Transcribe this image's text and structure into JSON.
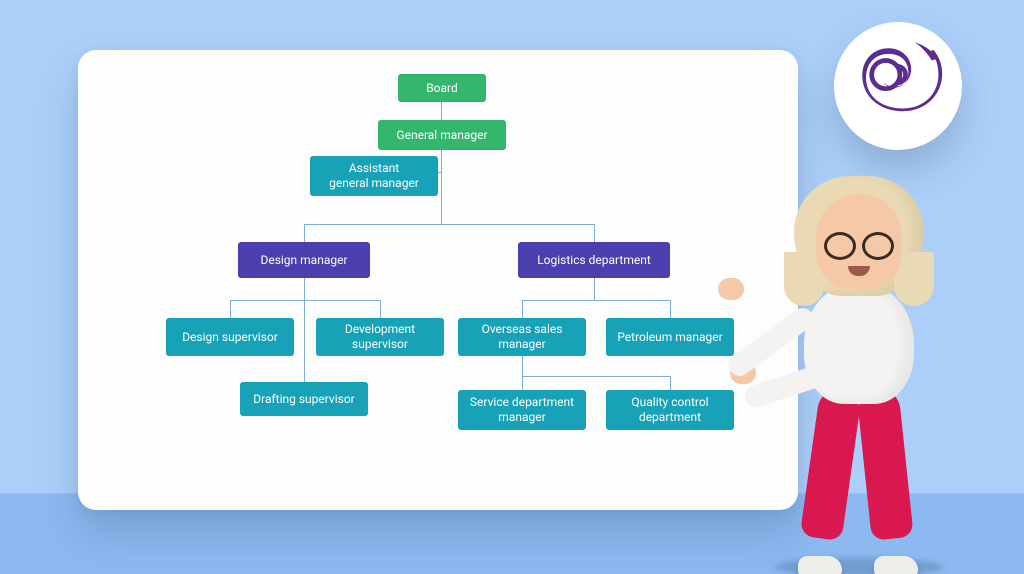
{
  "colors": {
    "bg_top": "#abcff8",
    "bg_floor": "#8bb9f0",
    "node_green": "#35b66d",
    "node_teal": "#17a2b8",
    "node_purple": "#4b3fae",
    "connector": "#7faed3",
    "logo_purple": "#5c2d91",
    "pants": "#d9184f"
  },
  "logo": {
    "name": "blazor-logo"
  },
  "org": {
    "board": "Board",
    "general_manager": "General manager",
    "assistant_gm": "Assistant\ngeneral manager",
    "design_manager": "Design manager",
    "logistics_dept": "Logistics department",
    "design_supervisor": "Design supervisor",
    "development_supervisor": "Development\nsupervisor",
    "drafting_supervisor": "Drafting supervisor",
    "overseas_sales_mgr": "Overseas sales\nmanager",
    "petroleum_mgr": "Petroleum manager",
    "service_dept_mgr": "Service department\nmanager",
    "quality_control_dept": "Quality control\ndepartment"
  }
}
